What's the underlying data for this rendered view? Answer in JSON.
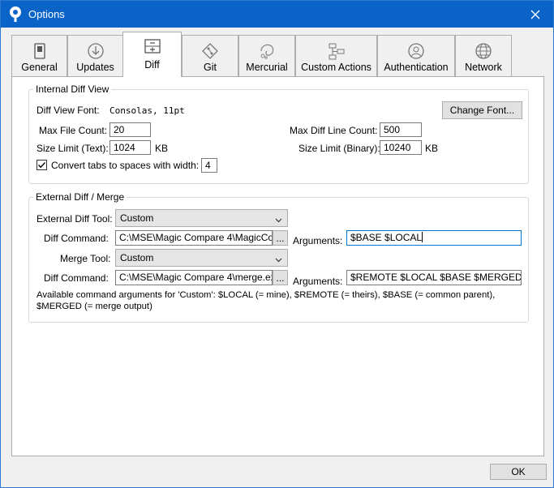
{
  "window": {
    "title": "Options"
  },
  "tabs": [
    {
      "label": "General",
      "icon": "toggle-switch-icon"
    },
    {
      "label": "Updates",
      "icon": "download-circle-icon"
    },
    {
      "label": "Diff",
      "icon": "diff-plus-minus-icon"
    },
    {
      "label": "Git",
      "icon": "git-diamond-icon"
    },
    {
      "label": "Mercurial",
      "icon": "mercurial-icon"
    },
    {
      "label": "Custom Actions",
      "icon": "flowchart-icon"
    },
    {
      "label": "Authentication",
      "icon": "user-circle-icon"
    },
    {
      "label": "Network",
      "icon": "globe-icon"
    }
  ],
  "active_tab": "Diff",
  "internal": {
    "title": "Internal Diff View",
    "font_label": "Diff View Font:",
    "font_value": "Consolas, 11pt",
    "change_font": "Change Font...",
    "max_file_count_label": "Max File Count:",
    "max_file_count": "20",
    "max_diff_line_label": "Max Diff Line Count:",
    "max_diff_line": "500",
    "size_text_label": "Size Limit (Text):",
    "size_text": "1024",
    "size_text_unit": "KB",
    "size_binary_label": "Size Limit (Binary):",
    "size_binary": "10240",
    "size_binary_unit": "KB",
    "convert_tabs_label": "Convert tabs to spaces with width:",
    "convert_tabs_checked": true,
    "tab_width": "4"
  },
  "external": {
    "title": "External Diff / Merge",
    "diff_tool_label": "External Diff Tool:",
    "diff_tool": "Custom",
    "diff_command_label": "Diff Command:",
    "diff_command": "C:\\MSE\\Magic Compare 4\\MagicCo",
    "diff_args_label": "Arguments:",
    "diff_args": "$BASE $LOCAL",
    "merge_tool_label": "Merge Tool:",
    "merge_tool": "Custom",
    "merge_command_label": "Diff Command:",
    "merge_command": "C:\\MSE\\Magic Compare 4\\merge.ex",
    "merge_args_label": "Arguments:",
    "merge_args": "$REMOTE $LOCAL $BASE $MERGED",
    "browse": "...",
    "help_line1": "Available command arguments for 'Custom': $LOCAL (= mine), $REMOTE (= theirs), $BASE (= common parent),",
    "help_line2": "$MERGED (= merge output)"
  },
  "footer": {
    "ok": "OK"
  }
}
